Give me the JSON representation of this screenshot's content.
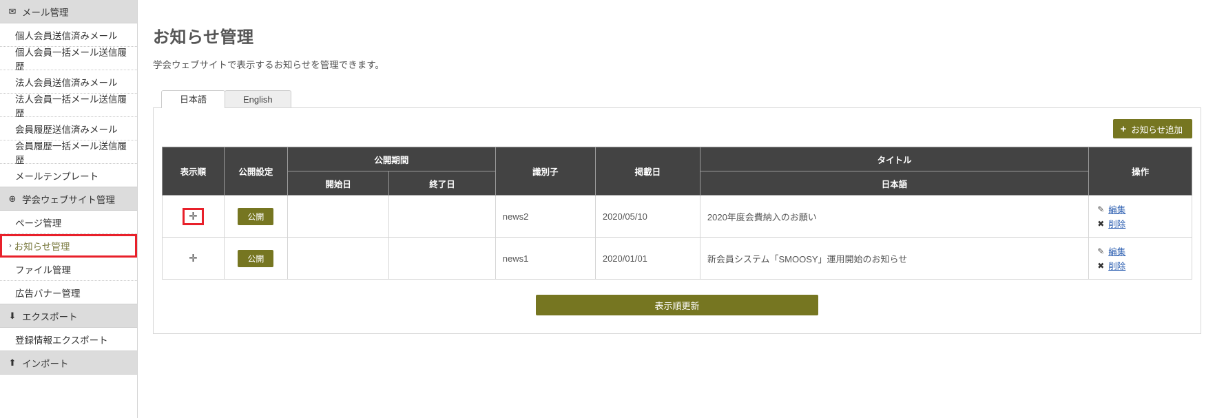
{
  "sidebar": {
    "groups": [
      {
        "label": "メール管理",
        "icon": "mail-icon",
        "glyph": "✉",
        "items": [
          {
            "label": "個人会員送信済みメール"
          },
          {
            "label": "個人会員一括メール送信履歴"
          },
          {
            "label": "法人会員送信済みメール"
          },
          {
            "label": "法人会員一括メール送信履歴"
          },
          {
            "label": "会員履歴送信済みメール"
          },
          {
            "label": "会員履歴一括メール送信履歴"
          },
          {
            "label": "メールテンプレート"
          }
        ]
      },
      {
        "label": "学会ウェブサイト管理",
        "icon": "globe-icon",
        "glyph": "⊕",
        "items": [
          {
            "label": "ページ管理"
          },
          {
            "label": "お知らせ管理",
            "active": true,
            "chevron": "›"
          },
          {
            "label": "ファイル管理"
          },
          {
            "label": "広告バナー管理"
          }
        ]
      },
      {
        "label": "エクスポート",
        "icon": "download-icon",
        "glyph": "⬇",
        "items": [
          {
            "label": "登録情報エクスポート"
          }
        ]
      },
      {
        "label": "インポート",
        "icon": "upload-icon",
        "glyph": "⬆",
        "items": []
      }
    ]
  },
  "main": {
    "title": "お知らせ管理",
    "description": "学会ウェブサイトで表示するお知らせを管理できます。",
    "tabs": [
      {
        "label": "日本語",
        "active": true
      },
      {
        "label": "English",
        "active": false
      }
    ],
    "add_button": {
      "label": "お知らせ追加",
      "plus": "+"
    },
    "update_button": {
      "label": "表示順更新"
    },
    "table": {
      "headers": {
        "order": "表示順",
        "publish_setting": "公開設定",
        "period": "公開期間",
        "period_start": "開始日",
        "period_end": "終了日",
        "identifier": "識別子",
        "posted_date": "掲載日",
        "title": "タイトル",
        "title_lang": "日本語",
        "operations": "操作"
      },
      "rows": [
        {
          "drag_glyph": "✛",
          "highlighted": true,
          "publish_status": "公開",
          "period_start": "",
          "period_end": "",
          "identifier": "news2",
          "posted_date": "2020/05/10",
          "title": "2020年度会費納入のお願い",
          "edit_label": "編集",
          "edit_glyph": "✎",
          "delete_label": "削除",
          "delete_glyph": "✖"
        },
        {
          "drag_glyph": "✛",
          "highlighted": false,
          "publish_status": "公開",
          "period_start": "",
          "period_end": "",
          "identifier": "news1",
          "posted_date": "2020/01/01",
          "title": "新会員システム「SMOOSY」運用開始のお知らせ",
          "edit_label": "編集",
          "edit_glyph": "✎",
          "delete_label": "削除",
          "delete_glyph": "✖"
        }
      ]
    }
  },
  "colors": {
    "accent_olive": "#767621",
    "highlight_red": "#e8202a",
    "header_dark": "#434343",
    "sidebar_group_bg": "#dcdcdc",
    "link_blue": "#2a5db0"
  }
}
